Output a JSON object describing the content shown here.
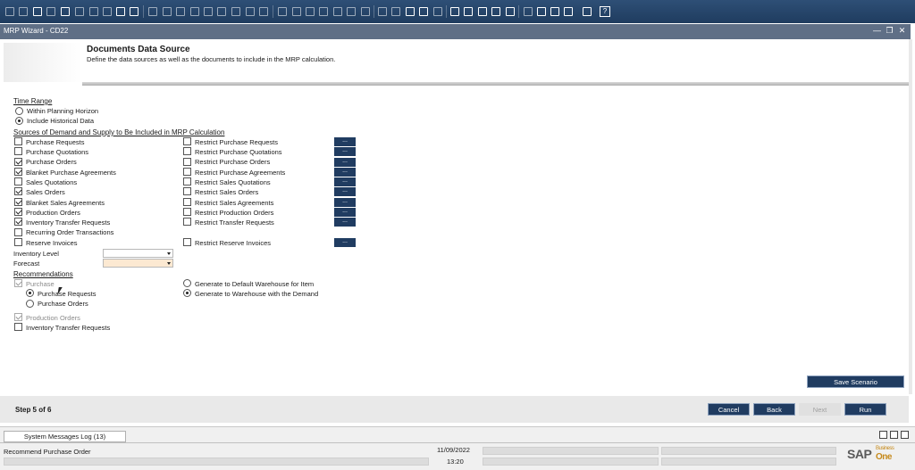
{
  "toolbar": {
    "help_label": "?"
  },
  "window": {
    "title": "MRP Wizard - CD22",
    "minimize": "—",
    "restore": "❐",
    "close": "✕"
  },
  "header": {
    "title": "Documents Data Source",
    "subtitle": "Define the data sources as well as the documents to include in the MRP calculation."
  },
  "time_range": {
    "heading": "Time Range",
    "options": [
      {
        "label": "Within Planning Horizon",
        "selected": false
      },
      {
        "label": "Include Historical Data",
        "selected": true
      }
    ]
  },
  "sources": {
    "heading": "Sources of Demand and Supply to Be Included in MRP Calculation",
    "left": [
      {
        "label": "Purchase Requests",
        "checked": false
      },
      {
        "label": "Purchase Quotations",
        "checked": false
      },
      {
        "label": "Purchase Orders",
        "checked": true
      },
      {
        "label": "Blanket Purchase Agreements",
        "checked": true
      },
      {
        "label": "Sales Quotations",
        "checked": false
      },
      {
        "label": "Sales Orders",
        "checked": true
      },
      {
        "label": "Blanket Sales Agreements",
        "checked": true
      },
      {
        "label": "Production Orders",
        "checked": true
      },
      {
        "label": "Inventory Transfer Requests",
        "checked": true
      },
      {
        "label": "Recurring Order Transactions",
        "checked": false
      },
      {
        "label": "Reserve Invoices",
        "checked": false
      }
    ],
    "restrict": [
      {
        "label": "Restrict Purchase Requests",
        "checked": false
      },
      {
        "label": "Restrict Purchase Quotations",
        "checked": false
      },
      {
        "label": "Restrict Purchase Orders",
        "checked": false
      },
      {
        "label": "Restrict Purchase Agreements",
        "checked": false
      },
      {
        "label": "Restrict Sales Quotations",
        "checked": false
      },
      {
        "label": "Restrict Sales Orders",
        "checked": false
      },
      {
        "label": "Restrict Sales Agreements",
        "checked": false
      },
      {
        "label": "Restrict Production Orders",
        "checked": false
      },
      {
        "label": "Restrict Transfer Requests",
        "checked": false
      },
      {
        "label": "Restrict Reserve Invoices",
        "checked": false
      }
    ],
    "browse_label": "..."
  },
  "inventory_level": {
    "label": "Inventory Level",
    "value": ""
  },
  "forecast": {
    "label": "Forecast",
    "value": ""
  },
  "recommendations": {
    "heading": "Recommendations",
    "purchase": {
      "label": "Purchase",
      "checked": true,
      "disabled": true
    },
    "purchase_options": [
      {
        "label": "Purchase Requests",
        "selected": true
      },
      {
        "label": "Purchase Orders",
        "selected": false
      }
    ],
    "warehouse_options": [
      {
        "label": "Generate to Default Warehouse for Item",
        "selected": false
      },
      {
        "label": "Generate to Warehouse with the Demand",
        "selected": true
      }
    ],
    "production_orders": {
      "label": "Production Orders",
      "checked": true,
      "disabled": true
    },
    "inventory_transfer": {
      "label": "Inventory Transfer Requests",
      "checked": false
    }
  },
  "footer": {
    "save_scenario": "Save Scenario",
    "step": "Step 5 of 6",
    "cancel": "Cancel",
    "back": "Back",
    "next": "Next",
    "run": "Run"
  },
  "status": {
    "log_tab": "System Messages Log (13)",
    "message": "Recommend Purchase Order",
    "date": "11/09/2022",
    "time": "13:20",
    "logo_sap": "SAP",
    "logo_business": "Business",
    "logo_one": "One"
  }
}
